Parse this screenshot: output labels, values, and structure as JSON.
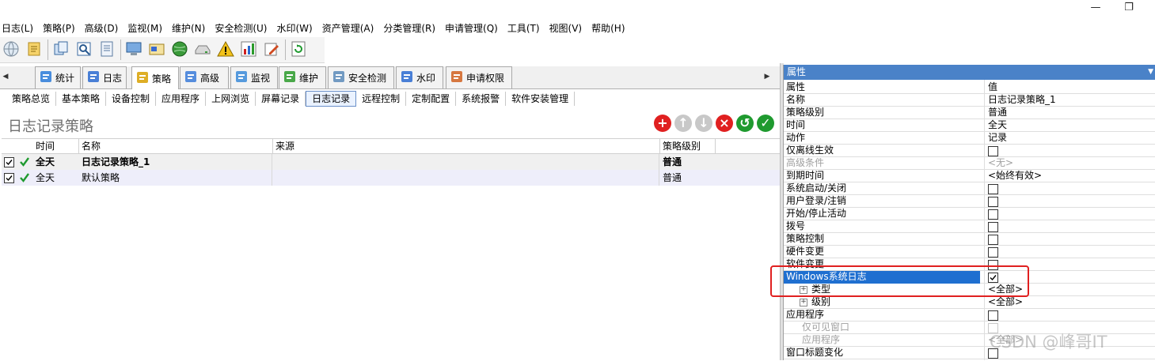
{
  "window": {
    "minimize_glyph": "—",
    "restore_glyph": "❐"
  },
  "menubar": [
    "日志(L)",
    "策略(P)",
    "高级(D)",
    "监视(M)",
    "维护(N)",
    "安全检测(U)",
    "水印(W)",
    "资产管理(A)",
    "分类管理(R)",
    "申请管理(Q)",
    "工具(T)",
    "视图(V)",
    "帮助(H)"
  ],
  "toolbar_icons": [
    "globe-icon",
    "notepad-icon",
    "copy-icon",
    "preview-icon",
    "report-icon",
    "computer-icon",
    "card-icon",
    "network-icon",
    "drive-icon",
    "warning-icon",
    "chart-icon",
    "edit-icon",
    "refresh-icon"
  ],
  "tabs": [
    {
      "label": "统计",
      "icon": "chart-icon",
      "color": "#2a7ad8"
    },
    {
      "label": "日志",
      "icon": "log-icon",
      "color": "#2a6ad0"
    },
    {
      "label": "策略",
      "icon": "policy-icon",
      "color": "#d8a000"
    },
    {
      "label": "高级",
      "icon": "advanced-icon",
      "color": "#3a7ad8"
    },
    {
      "label": "监视",
      "icon": "monitor-icon",
      "color": "#3a8ad8"
    },
    {
      "label": "维护",
      "icon": "maintain-icon",
      "color": "#2a9a2a"
    },
    {
      "label": "安全检测",
      "icon": "security-check-icon",
      "color": "#5a8ab8"
    },
    {
      "label": "水印",
      "icon": "watermark-icon",
      "color": "#2a6ad0"
    },
    {
      "label": "申请权限",
      "icon": "request-icon",
      "color": "#d06020"
    }
  ],
  "subtabs": [
    "策略总览",
    "基本策略",
    "设备控制",
    "应用程序",
    "上网浏览",
    "屏幕记录",
    "日志记录",
    "远程控制",
    "定制配置",
    "系统报警",
    "软件安装管理"
  ],
  "active_subtab": "日志记录",
  "policy_title": "日志记录策略",
  "actions": [
    {
      "name": "add-button",
      "color": "#e02020",
      "glyph": "+"
    },
    {
      "name": "move-up-button",
      "color": "#c8c8c8",
      "glyph": "↑"
    },
    {
      "name": "move-down-button",
      "color": "#c8c8c8",
      "glyph": "↓"
    },
    {
      "name": "delete-button",
      "color": "#e02020",
      "glyph": "×"
    },
    {
      "name": "undo-button",
      "color": "#1f9a2f",
      "glyph": "↺"
    },
    {
      "name": "apply-button",
      "color": "#1f9a2f",
      "glyph": "✓"
    }
  ],
  "grid": {
    "columns": [
      "时间",
      "名称",
      "来源",
      "策略级别"
    ],
    "rows": [
      {
        "time": "全天",
        "name": "日志记录策略_1",
        "source": "",
        "level": "普通",
        "checked": true,
        "enabled": true,
        "bold": true
      },
      {
        "time": "全天",
        "name": "默认策略",
        "source": "",
        "level": "普通",
        "checked": true,
        "enabled": true,
        "bold": false
      }
    ]
  },
  "properties": {
    "header": "属性",
    "rows": [
      {
        "name": "属性",
        "value": "值"
      },
      {
        "name": "名称",
        "value": "日志记录策略_1"
      },
      {
        "name": "策略级别",
        "value": "普通"
      },
      {
        "name": "时间",
        "value": "全天"
      },
      {
        "name": "动作",
        "value": "记录"
      },
      {
        "name": "仅离线生效",
        "checkbox": true,
        "checked": false
      },
      {
        "name": "高级条件",
        "value": "<无>",
        "dim": true
      },
      {
        "name": "到期时间",
        "value": "<始终有效>"
      },
      {
        "name": "系统启动/关闭",
        "checkbox": true,
        "checked": false
      },
      {
        "name": "用户登录/注销",
        "checkbox": true,
        "checked": false
      },
      {
        "name": "开始/停止活动",
        "checkbox": true,
        "checked": false
      },
      {
        "name": "拨号",
        "checkbox": true,
        "checked": false
      },
      {
        "name": "策略控制",
        "checkbox": true,
        "checked": false
      },
      {
        "name": "硬件变更",
        "checkbox": true,
        "checked": false
      },
      {
        "name": "软件变更",
        "checkbox": true,
        "checked": false
      },
      {
        "name": "Windows系统日志",
        "checkbox": true,
        "checked": true,
        "selected": true
      },
      {
        "name": "类型",
        "value": "<全部>",
        "expander": true,
        "indent": 1
      },
      {
        "name": "级别",
        "value": "<全部>",
        "expander": true,
        "indent": 1
      },
      {
        "name": "应用程序",
        "checkbox": true,
        "checked": false
      },
      {
        "name": "仅可见窗口",
        "checkbox": true,
        "checked": false,
        "dim": true,
        "indent": 1
      },
      {
        "name": "应用程序",
        "value": "<全部>",
        "dim": true,
        "indent": 1
      },
      {
        "name": "窗口标题变化",
        "checkbox": true,
        "checked": false
      }
    ]
  },
  "watermark": "CSDN @峰哥IT"
}
